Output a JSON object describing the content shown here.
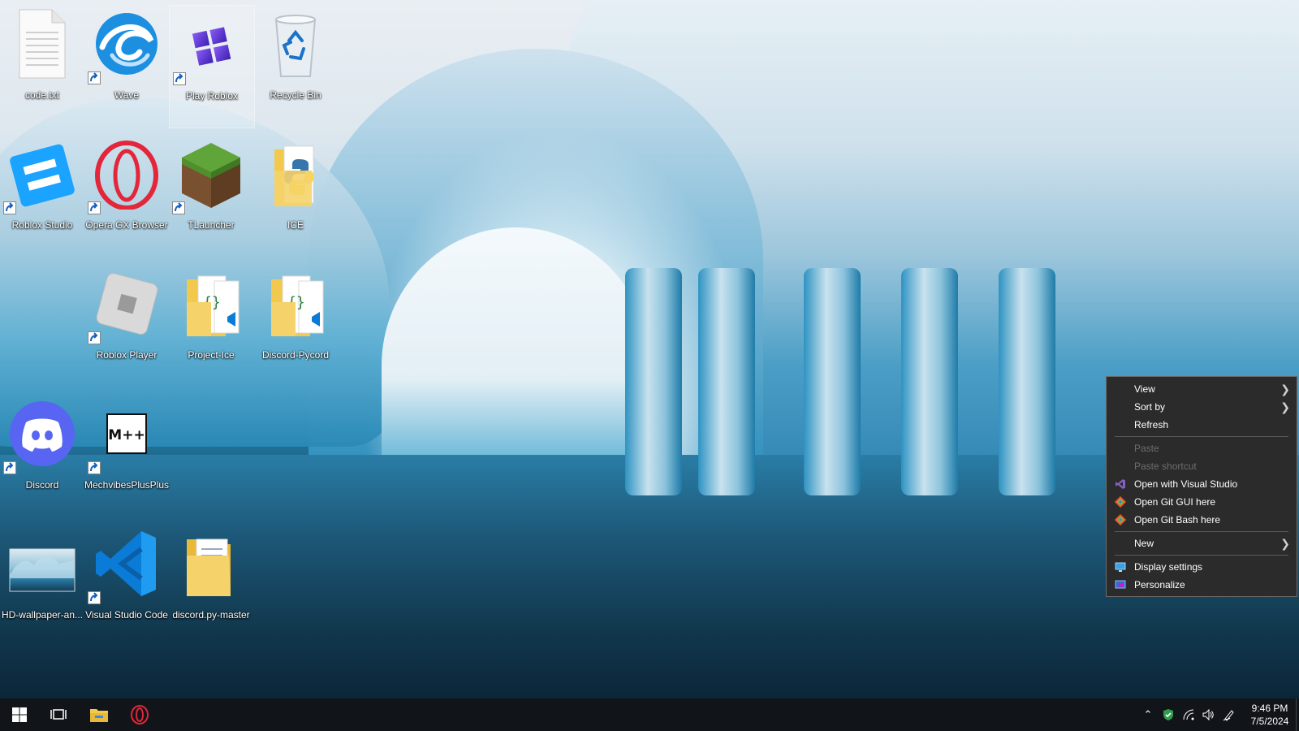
{
  "desktop": {
    "icons": [
      {
        "label": "code.txt",
        "icon": "text-file-icon"
      },
      {
        "label": "Wave",
        "icon": "wave-app-icon"
      },
      {
        "label": "Play Roblox",
        "icon": "play-roblox-icon"
      },
      {
        "label": "Recycle Bin",
        "icon": "recycle-bin-icon"
      },
      {
        "label": "Roblox Studio",
        "icon": "roblox-studio-icon"
      },
      {
        "label": "Opera GX Browser",
        "icon": "opera-gx-icon"
      },
      {
        "label": "TLauncher",
        "icon": "minecraft-grass-icon"
      },
      {
        "label": "ICE",
        "icon": "python-folder-icon"
      },
      {
        "label": "Roblox Player",
        "icon": "roblox-player-icon"
      },
      {
        "label": "Project-Ice",
        "icon": "vscode-folder-icon"
      },
      {
        "label": "Discord-Pycord",
        "icon": "vscode-folder-icon"
      },
      {
        "label": "Discord",
        "icon": "discord-icon"
      },
      {
        "label": "MechvibesPlusPlus",
        "icon": "mechvibes-icon"
      },
      {
        "label": "HD-wallpaper-an...",
        "icon": "image-thumbnail-icon"
      },
      {
        "label": "Visual Studio Code",
        "icon": "vscode-icon"
      },
      {
        "label": "discord.py-master",
        "icon": "folder-icon"
      }
    ]
  },
  "context_menu": {
    "items": {
      "view": "View",
      "sort_by": "Sort by",
      "refresh": "Refresh",
      "paste": "Paste",
      "paste_shortcut": "Paste shortcut",
      "open_vs": "Open with Visual Studio",
      "git_gui": "Open Git GUI here",
      "git_bash": "Open Git Bash here",
      "new": "New",
      "display_settings": "Display settings",
      "personalize": "Personalize"
    }
  },
  "taskbar": {
    "time": "9:46 PM",
    "date": "7/5/2024",
    "pinned": [
      "windows-start-icon",
      "task-view-icon",
      "file-explorer-icon",
      "opera-gx-icon"
    ],
    "tray": [
      "chevron-up-icon",
      "windows-security-icon",
      "network-icon",
      "volume-icon",
      "pen-icon"
    ]
  },
  "colors": {
    "menu_bg": "#2b2b2b",
    "taskbar_bg": "#111418",
    "discord_blurple": "#5865f2",
    "vscode_blue": "#0a7bd6",
    "opera_red": "#e3263a"
  }
}
